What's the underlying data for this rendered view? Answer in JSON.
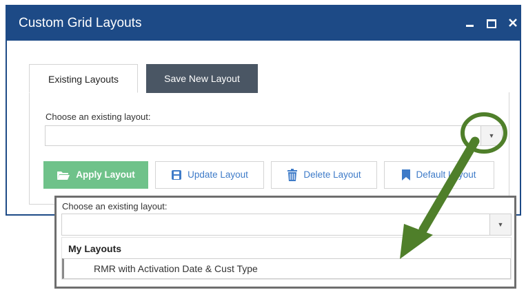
{
  "window": {
    "title": "Custom Grid Layouts",
    "controls": {
      "minimize": "–",
      "maximize": "□",
      "close": "×"
    }
  },
  "tabs": [
    {
      "label": "Existing Layouts",
      "active": true
    },
    {
      "label": "Save New Layout",
      "active": false
    }
  ],
  "panel": {
    "choose_label": "Choose an existing layout:",
    "select_value": "",
    "buttons": {
      "apply": "Apply Layout",
      "update": "Update Layout",
      "delete": "Delete Layout",
      "default": "Default Layout"
    }
  },
  "callout": {
    "choose_label": "Choose an existing layout:",
    "select_value": "",
    "group_label": "My Layouts",
    "options": [
      "RMR with Activation Date & Cust Type"
    ]
  },
  "icons": {
    "apply": "folder-open-icon",
    "update": "save-icon",
    "delete": "trash-icon",
    "default": "bookmark-icon",
    "dropdown": "caret-down-icon"
  },
  "colors": {
    "titlebar": "#1d4a86",
    "tab_inactive": "#4a5664",
    "apply_button": "#6fc28a",
    "link_blue": "#3e7bc8",
    "annotation_green": "#4f7f2a"
  }
}
